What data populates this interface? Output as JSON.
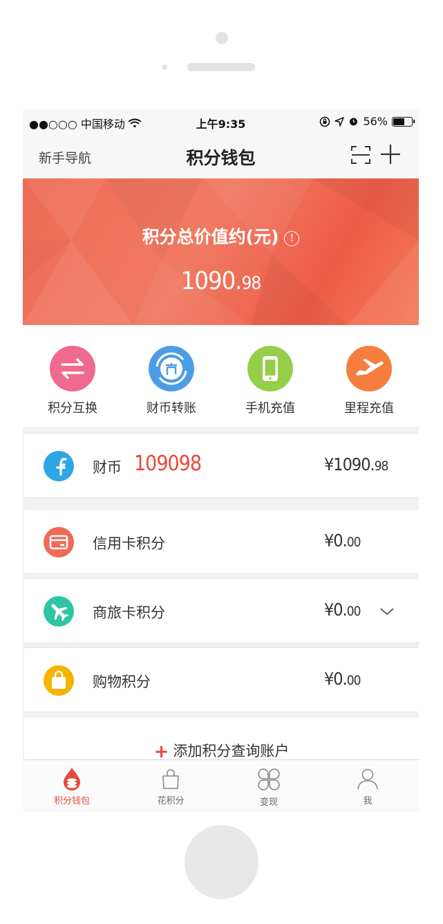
{
  "status_bar": {
    "carrier": "●●○○○ 中国移动",
    "time": "上午9:35",
    "battery_percent": "56%"
  },
  "nav": {
    "left": "新手导航",
    "title": "积分钱包",
    "icons": [
      "scan-icon",
      "plus-icon"
    ]
  },
  "hero": {
    "label": "积分总价值约(元)",
    "info_glyph": "!",
    "value_int": "1090.",
    "value_dec": "98",
    "colors": {
      "from": "#ef6b55",
      "to": "#f27b58"
    }
  },
  "quick_actions": [
    {
      "label": "积分互换",
      "icon": "exchange-icon",
      "color": "#f0698f"
    },
    {
      "label": "财币转账",
      "icon": "coin-transfer-icon",
      "color": "#4d9de6"
    },
    {
      "label": "手机充值",
      "icon": "phone-icon",
      "color": "#95cf4a"
    },
    {
      "label": "里程充值",
      "icon": "plane-icon",
      "color": "#f57d3e"
    }
  ],
  "accounts": [
    {
      "name": "财币",
      "balance": "109098",
      "amount_int": "¥1090.",
      "amount_dec": "98",
      "icon": "f-icon",
      "color": "#2ea6e6"
    },
    {
      "name": "信用卡积分",
      "amount_int": "¥0.",
      "amount_dec": "00",
      "icon": "credit-card-icon",
      "color": "#ef6b55"
    },
    {
      "name": "商旅卡积分",
      "amount_int": "¥0.",
      "amount_dec": "00",
      "icon": "airplane-icon",
      "color": "#2fc5a4"
    },
    {
      "name": "购物积分",
      "amount_int": "¥0.",
      "amount_dec": "00",
      "icon": "shopping-bag-icon",
      "color": "#f5b400"
    }
  ],
  "add_account": {
    "plus": "+",
    "label": "添加积分查询账户"
  },
  "tabs": [
    {
      "label": "积分钱包",
      "icon": "wallet-drop-icon",
      "active": true
    },
    {
      "label": "花积分",
      "icon": "bag-icon",
      "active": false
    },
    {
      "label": "变现",
      "icon": "clover-icon",
      "active": false
    },
    {
      "label": "我",
      "icon": "user-icon",
      "active": false
    }
  ],
  "accent_color": "#e8483a"
}
